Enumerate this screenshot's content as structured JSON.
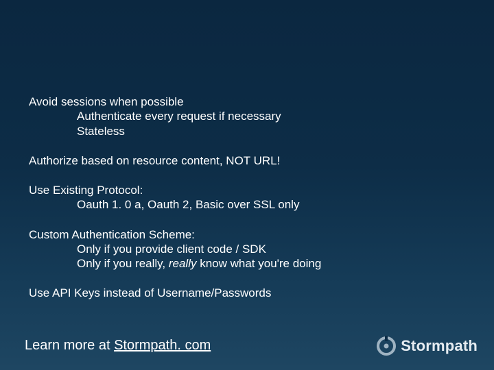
{
  "content": {
    "block1_line1": "Avoid sessions when possible",
    "block1_sub1": "Authenticate every request if necessary",
    "block1_sub2": "Stateless",
    "block2_line1": "Authorize based on resource content, NOT URL!",
    "block3_line1": "Use Existing Protocol:",
    "block3_sub1": "Oauth 1. 0 a, Oauth 2, Basic over SSL only",
    "block4_line1": "Custom Authentication Scheme:",
    "block4_sub1": "Only if you provide client code / SDK",
    "block4_sub2_pre": "Only if you really, ",
    "block4_sub2_em": "really",
    "block4_sub2_post": " know what you're doing",
    "block5_line1": "Use API Keys instead of Username/Passwords"
  },
  "footer": {
    "prefix": "Learn more at ",
    "link_text": "Stormpath. com"
  },
  "brand": {
    "name": "Stormpath"
  }
}
